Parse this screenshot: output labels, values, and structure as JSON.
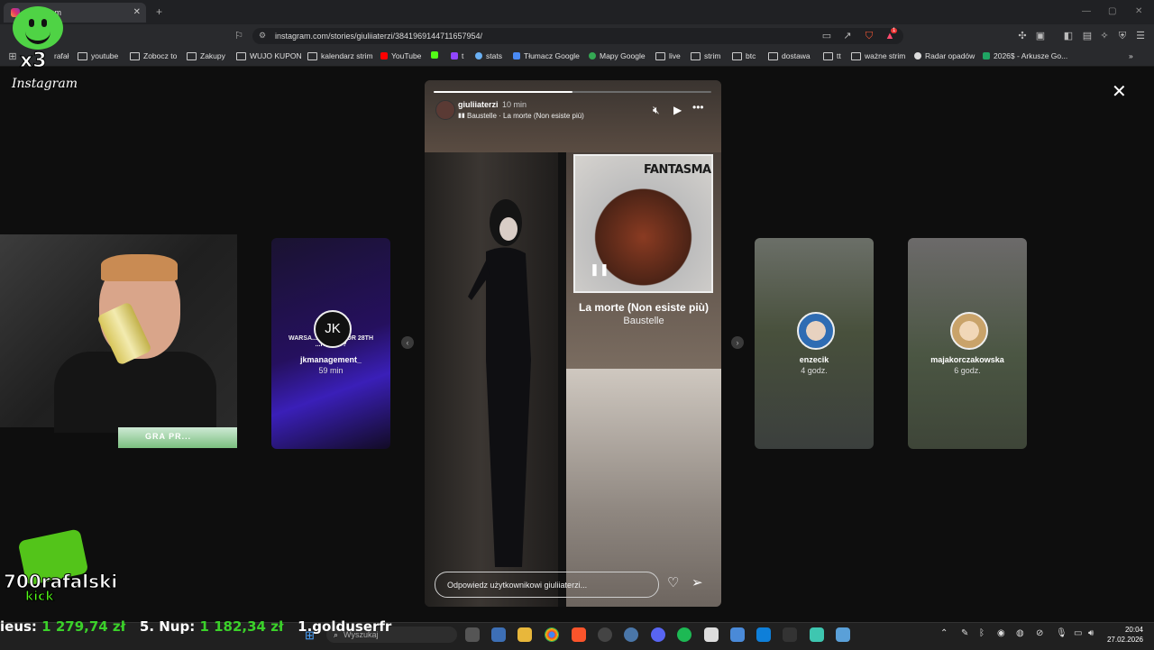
{
  "browser": {
    "tab_title": "Instagram",
    "url": "instagram.com/stories/giuliiaterzi/3841969144711657954/",
    "notification_count": "1"
  },
  "bookmarks": [
    "rafał",
    "youtube",
    "Zobocz to",
    "Zakupy",
    "WUJO KUPON",
    "kalendarz strim",
    "YouTube",
    "t",
    "stats",
    "Tłumacz Google",
    "Mapy Google",
    "live",
    "strim",
    "btc",
    "dostawa",
    "tt",
    "ważne strim",
    "Radar opadów",
    "2026$ - Arkusze Go..."
  ],
  "instagram": {
    "logo": "Instagram",
    "close_label": "✕",
    "story": {
      "username": "giuliiaterzi",
      "time": "10 min",
      "music": "Baustelle · La morte (Non esiste più)",
      "album_title": "FANTASMA",
      "song_title": "La morte (Non esiste più)",
      "song_artist": "Baustelle",
      "reply_placeholder": "Odpowiedz użytkownikowi giuliiaterzi...",
      "progress": 0.5
    },
    "side_stories": [
      {
        "username": "jkmanagement_",
        "time": "59 min",
        "initials": "JK",
        "overlay_text": "WARSA... READY FOR 28TH ...RUARY?"
      },
      {
        "username": "enzecik",
        "time": "4 godz."
      },
      {
        "username": "majakorczakowska",
        "time": "6 godz."
      }
    ]
  },
  "overlay": {
    "x3": "x3",
    "streamer": "700rafalski",
    "platform": "kick",
    "ticker": [
      {
        "text": "ieus: ",
        "color": "#ffffff"
      },
      {
        "text": "1 279,74 zł",
        "color": "#3bd12a"
      },
      {
        "text": "   5. Nup: ",
        "color": "#ffffff"
      },
      {
        "text": "1 182,34 zł",
        "color": "#3bd12a"
      },
      {
        "text": "   1.golduserfr",
        "color": "#ffffff"
      }
    ],
    "banner": "GRA PR..."
  },
  "taskbar": {
    "search_placeholder": "Wyszukaj",
    "time": "20:04",
    "date": "27.02.2026"
  }
}
